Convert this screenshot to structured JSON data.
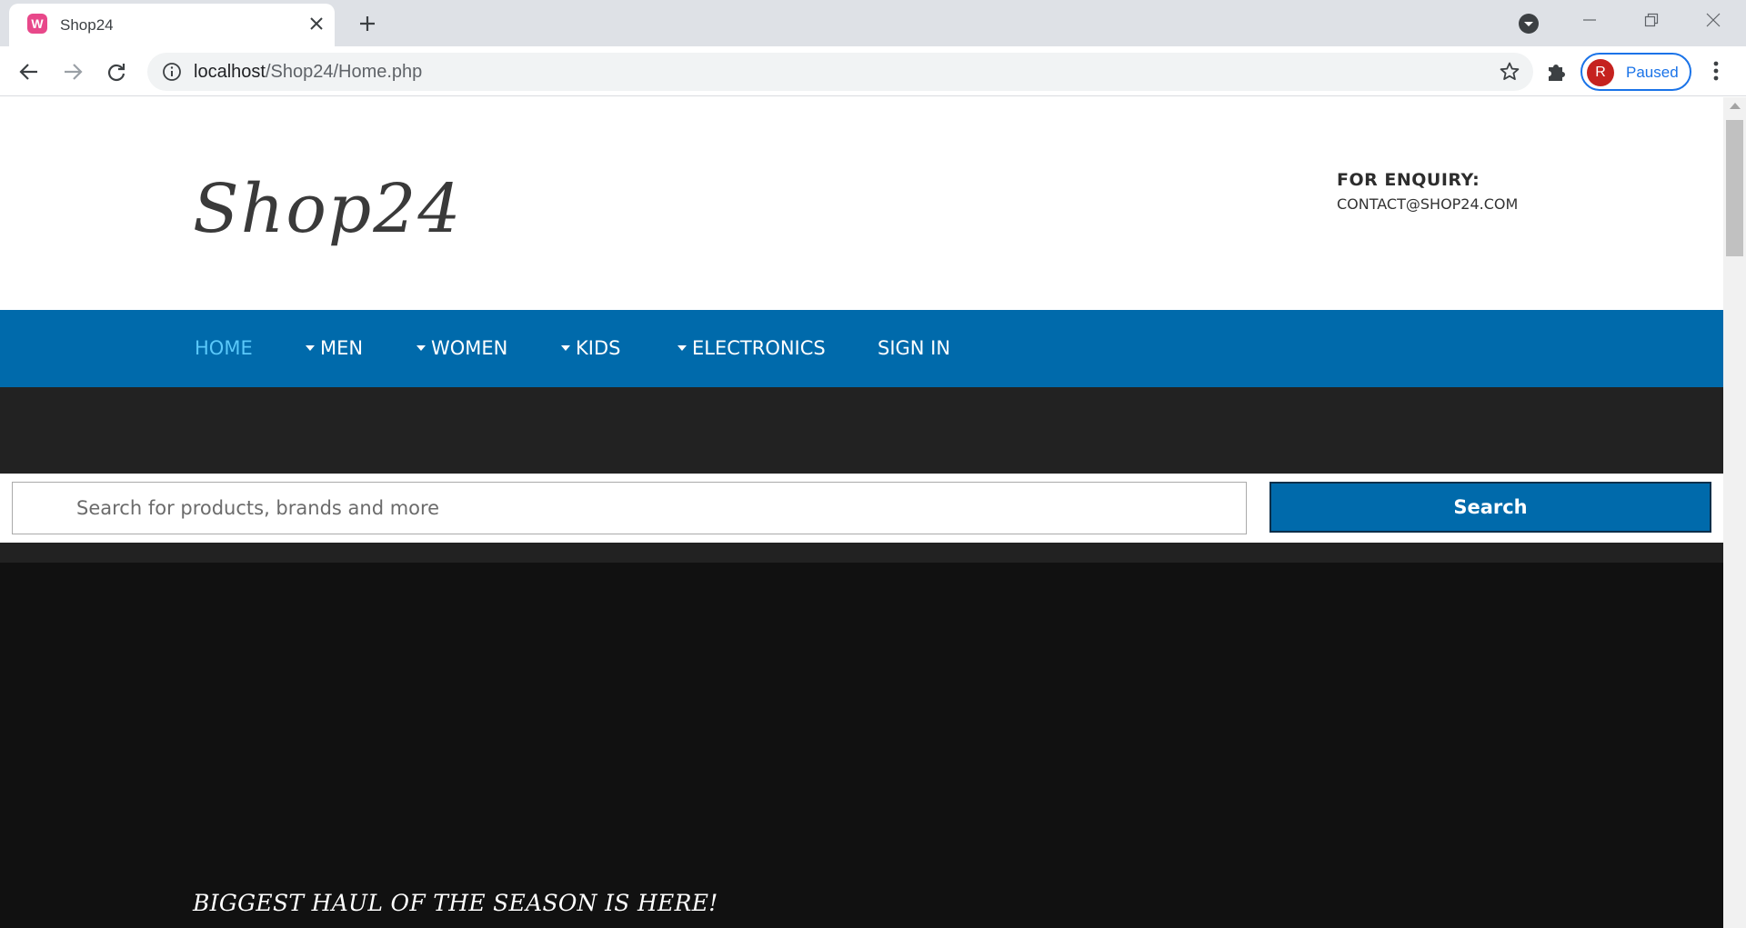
{
  "browser": {
    "tab_title": "Shop24",
    "favicon_letter": "W",
    "url_host": "localhost",
    "url_path": "/Shop24/Home.php",
    "profile_initial": "R",
    "profile_status": "Paused"
  },
  "site": {
    "logo": "Shop24",
    "enquiry_title": "FOR ENQUIRY:",
    "enquiry_email": "CONTACT@SHOP24.COM"
  },
  "nav": {
    "home": "HOME",
    "men": "MEN",
    "women": "WOMEN",
    "kids": "KIDS",
    "electronics": "ELECTRONICS",
    "sign_in": "SIGN IN",
    "active_color": "#5ac8fa",
    "bar_color": "#006aab"
  },
  "search": {
    "placeholder": "Search for products, brands and more",
    "button_label": "Search"
  },
  "hero": {
    "headline": "BIGGEST HAUL OF THE SEASON IS HERE!"
  }
}
